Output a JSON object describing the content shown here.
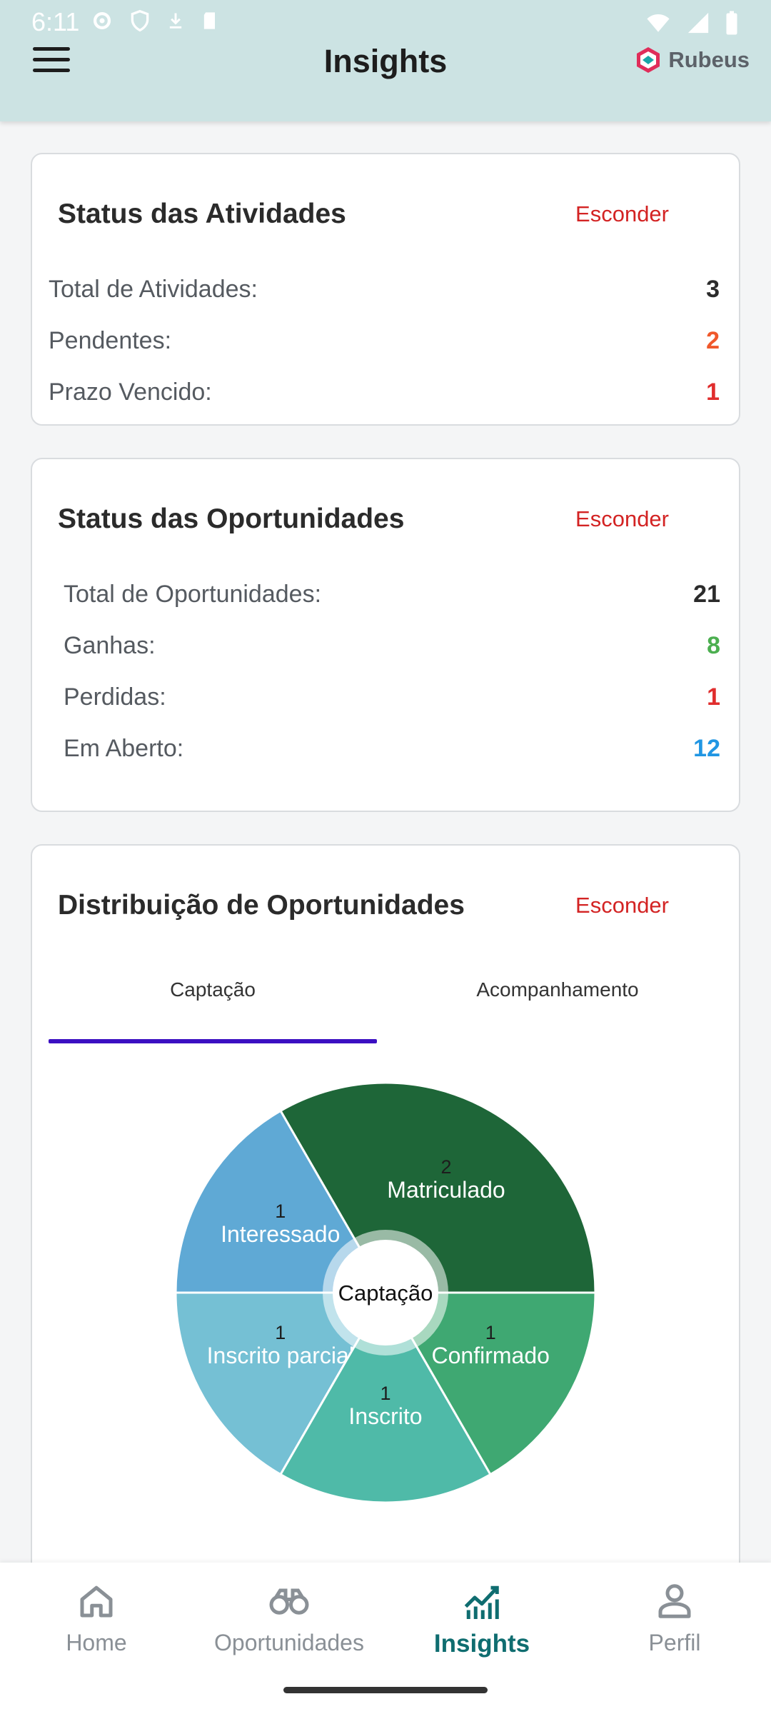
{
  "status_bar": {
    "time": "6:11"
  },
  "header": {
    "title": "Insights",
    "brand": "Rubeus"
  },
  "activities": {
    "title": "Status das Atividades",
    "hide_label": "Esconder",
    "rows": [
      {
        "label": "Total de Atividades:",
        "value": "3",
        "color": "#2b2b2b"
      },
      {
        "label": "Pendentes:",
        "value": "2",
        "color": "#f0582b"
      },
      {
        "label": "Prazo Vencido:",
        "value": "1",
        "color": "#e02d2d"
      }
    ]
  },
  "opportunities": {
    "title": "Status das Oportunidades",
    "hide_label": "Esconder",
    "rows": [
      {
        "label": "Total de Oportunidades:",
        "value": "21",
        "color": "#2b2b2b"
      },
      {
        "label": "Ganhas:",
        "value": "8",
        "color": "#4caf50"
      },
      {
        "label": "Perdidas:",
        "value": "1",
        "color": "#e02d2d"
      },
      {
        "label": "Em Aberto:",
        "value": "12",
        "color": "#2196e3"
      }
    ]
  },
  "distribution": {
    "title": "Distribuição de Oportunidades",
    "hide_label": "Esconder",
    "tabs": [
      {
        "label": "Captação",
        "active": true
      },
      {
        "label": "Acompanhamento",
        "active": false
      }
    ]
  },
  "chart_data": {
    "type": "pie",
    "center_label": "Captação",
    "slices": [
      {
        "label": "Matriculado",
        "value": 2,
        "color": "#1e6638"
      },
      {
        "label": "Interessado",
        "value": 1,
        "color": "#5fa9d5"
      },
      {
        "label": "Inscrito parcial",
        "value": 1,
        "color": "#75c0d4"
      },
      {
        "label": "Inscrito",
        "value": 1,
        "color": "#4fbaa8"
      },
      {
        "label": "Confirmado",
        "value": 1,
        "color": "#3fa872"
      }
    ]
  },
  "bottom_nav": {
    "items": [
      {
        "label": "Home",
        "icon": "home-icon",
        "active": false
      },
      {
        "label": "Oportunidades",
        "icon": "binoculars-icon",
        "active": false
      },
      {
        "label": "Insights",
        "icon": "chart-icon",
        "active": true
      },
      {
        "label": "Perfil",
        "icon": "person-icon",
        "active": false
      }
    ]
  }
}
